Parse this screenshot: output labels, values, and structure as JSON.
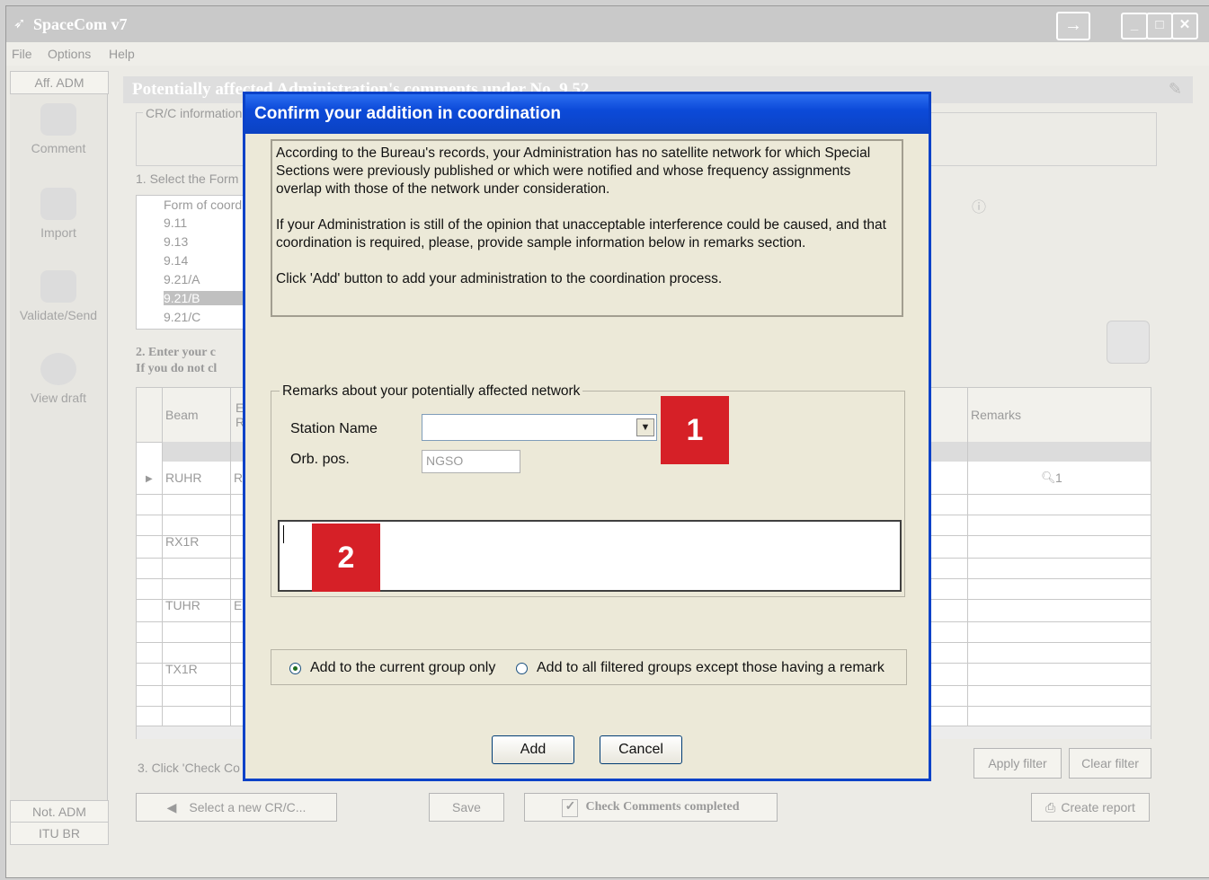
{
  "window": {
    "title": "SpaceCom v7",
    "menu": [
      "File",
      "Options",
      "Help"
    ]
  },
  "sidebar": {
    "top_tab": "Aff. ADM",
    "items": [
      {
        "label": "Comment",
        "icon": "edit-icon"
      },
      {
        "label": "Import",
        "icon": "import-icon"
      },
      {
        "label": "Validate/Send",
        "icon": "envelope-icon"
      },
      {
        "label": "View draft",
        "icon": "disc-icon"
      }
    ],
    "bottom_tabs": [
      "Not. ADM",
      "ITU BR"
    ]
  },
  "main": {
    "header": "Potentially affected Administration's comments under No. 9.52",
    "crc_legend": "CR/C information",
    "step1": "1. Select the Form",
    "form_header": "Form of coord",
    "forms": [
      "9.11",
      "9.13",
      "9.14",
      "9.21/A",
      "9.21/B",
      "9.21/C"
    ],
    "step2_line1": "2. Enter your c",
    "step2_line2": "If you do not cl",
    "grid": {
      "col_beam": "Beam",
      "col_e": "E",
      "col_r": "R",
      "col_remarks": "Remarks",
      "rows": [
        {
          "beam": "RUHR",
          "e": "R"
        },
        {
          "beam": "RX1R",
          "e": ""
        },
        {
          "beam": "TUHR",
          "e": "E"
        },
        {
          "beam": "TX1R",
          "e": ""
        }
      ],
      "remark_count": "1"
    },
    "step3": "3. Click 'Check Co",
    "apply_filter": "Apply filter",
    "clear_filter": "Clear filter",
    "select_new": "Select a new CR/C...",
    "save": "Save",
    "check_comments": "Check Comments completed",
    "create_report": "Create report"
  },
  "dialog": {
    "title": "Confirm your addition in coordination",
    "info_p1": "According to the Bureau's records, your Administration has no satellite network for which Special Sections were previously published or which were notified and whose frequency assignments overlap with those of the network under consideration.",
    "info_p2": "If your Administration is still of the opinion that unacceptable interference could be caused, and that coordination is required, please, provide sample information below in remarks section.",
    "info_p3": "Click 'Add' button to add your administration to the coordination process.",
    "group_legend": "Remarks about your potentially affected network",
    "station_name_label": "Station Name",
    "station_name_value": "",
    "orb_pos_label": "Orb. pos.",
    "orb_pos_value": "NGSO",
    "remarks_value": "",
    "radio_current": "Add to the current group only",
    "radio_all": "Add to all filtered groups except those having a remark",
    "radio_selected": "current",
    "add_button": "Add",
    "cancel_button": "Cancel"
  },
  "callouts": {
    "one": "1",
    "two": "2"
  },
  "colors": {
    "dialog_title": "#0c4ad9",
    "callout": "#d62027",
    "dialog_bg": "#ece9d8"
  }
}
